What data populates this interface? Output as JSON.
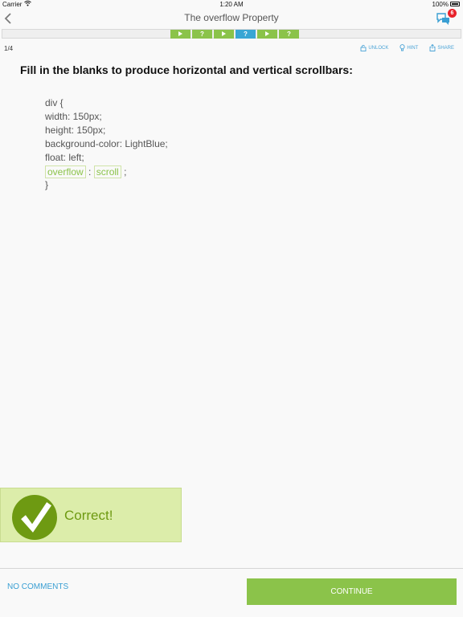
{
  "status": {
    "carrier": "Carrier",
    "time": "1:20 AM",
    "battery": "100%"
  },
  "nav": {
    "title": "The overflow Property",
    "back_icon": "chevron-left-icon",
    "comments_badge": "6"
  },
  "progress": {
    "steps": [
      {
        "kind": "play",
        "label": ""
      },
      {
        "kind": "question",
        "label": "?"
      },
      {
        "kind": "play",
        "label": ""
      },
      {
        "kind": "question",
        "label": "?",
        "current": true
      },
      {
        "kind": "play",
        "label": ""
      },
      {
        "kind": "question",
        "label": "?"
      }
    ]
  },
  "counter": "1/4",
  "actions": {
    "unlock": "UNLOCK",
    "hint": "HINT",
    "share": "SHARE"
  },
  "question": "Fill in the blanks to produce horizontal and vertical scrollbars:",
  "code": {
    "lines": [
      "div {",
      "width: 150px;",
      "height: 150px;",
      "background-color: LightBlue;",
      "float: left;"
    ],
    "blank1": "overflow",
    "separator": ":",
    "blank2": "scroll",
    "terminator": ";",
    "closing": "}"
  },
  "result": {
    "label": "Correct!"
  },
  "footer": {
    "comments": "NO COMMENTS",
    "continue": "CONTINUE"
  },
  "colors": {
    "accent_green": "#8bc34a",
    "accent_blue": "#38a6d4",
    "badge_red": "#e8232b"
  }
}
